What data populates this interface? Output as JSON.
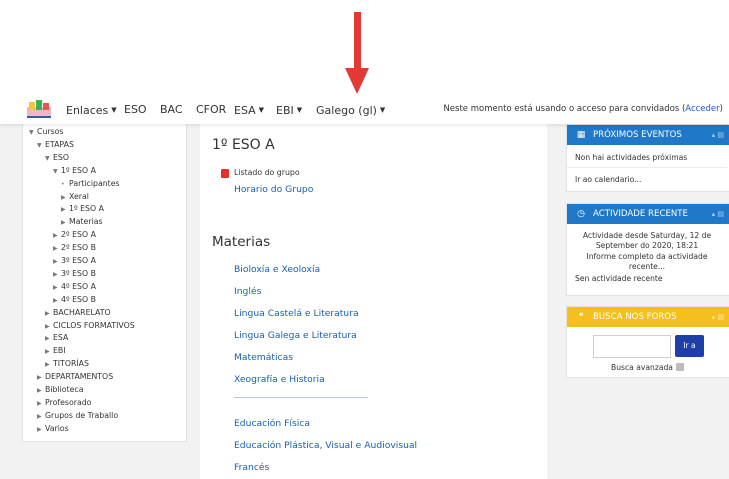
{
  "navbar": {
    "menu": [
      {
        "label": "Enlaces",
        "caret": true
      },
      {
        "label": "ESO",
        "caret": false
      },
      {
        "label": "BAC",
        "caret": false
      },
      {
        "label": "CFOR",
        "caret": false
      },
      {
        "label": "ESA",
        "caret": true
      },
      {
        "label": "EBI",
        "caret": true
      },
      {
        "label": "Galego (gl)",
        "caret": true
      }
    ],
    "login_text": "Neste momento está usando o acceso para convidados (",
    "login_link": "Acceder",
    "login_close": ")"
  },
  "tree": [
    {
      "label": "Cursos",
      "state": "open"
    },
    {
      "label": "ETAPAS",
      "state": "open"
    },
    {
      "label": "ESO",
      "state": "open"
    },
    {
      "label": "1º ESO A",
      "state": "open"
    },
    {
      "label": "Participantes",
      "state": "leaf"
    },
    {
      "label": "Xeral",
      "state": "closed"
    },
    {
      "label": "1º ESO A",
      "state": "closed"
    },
    {
      "label": "Materias",
      "state": "closed"
    },
    {
      "label": "2º ESO A",
      "state": "closed"
    },
    {
      "label": "2º ESO B",
      "state": "closed"
    },
    {
      "label": "3º ESO A",
      "state": "closed"
    },
    {
      "label": "3º ESO B",
      "state": "closed"
    },
    {
      "label": "4º ESO A",
      "state": "closed"
    },
    {
      "label": "4º ESO B",
      "state": "closed"
    },
    {
      "label": "BACHARELATO",
      "state": "closed"
    },
    {
      "label": "CICLOS FORMATIVOS",
      "state": "closed"
    },
    {
      "label": "ESA",
      "state": "closed"
    },
    {
      "label": "EBI",
      "state": "closed"
    },
    {
      "label": "TITORÍAS",
      "state": "closed"
    },
    {
      "label": "DEPARTAMENTOS",
      "state": "closed"
    },
    {
      "label": "Biblioteca",
      "state": "closed"
    },
    {
      "label": "Profesorado",
      "state": "closed"
    },
    {
      "label": "Grupos de Traballo",
      "state": "closed"
    },
    {
      "label": "Varios",
      "state": "closed"
    }
  ],
  "main": {
    "course_title": "1º ESO A",
    "resource_label": "Listado do grupo",
    "schedule_link": "Horario do Grupo",
    "section_title": "Materias",
    "subjects_a": [
      "Bioloxía e Xeoloxía",
      "Inglés",
      "Lingua Castelá e Literatura",
      "Lingua Galega e Literatura",
      "Matemáticas",
      "Xeografía e Historia"
    ],
    "subjects_b": [
      "Educación Física",
      "Educación Plástica, Visual e Audiovisual",
      "Francés"
    ]
  },
  "events": {
    "title": "PRÓXIMOS EVENTOS",
    "empty": "Non hai actividades próximas",
    "calendar_link": "Ir ao calendario..."
  },
  "recent": {
    "title": "ACTIVIDADE RECENTE",
    "since_line1": "Actividade desde Saturday, 12 de",
    "since_line2": "September do 2020, 18:21",
    "report_line1": "Informe completo da actividade",
    "report_line2": "recente...",
    "none": "Sen actividade recente"
  },
  "forum_search": {
    "title": "BUSCA NOS FOROS",
    "button": "Ir a",
    "advanced": "Busca avanzada"
  },
  "colors": {
    "accent_blue": "#1f78c8",
    "forum_yellow": "#f5c01e",
    "link": "#1a5fb4",
    "arrow": "#e53935"
  }
}
